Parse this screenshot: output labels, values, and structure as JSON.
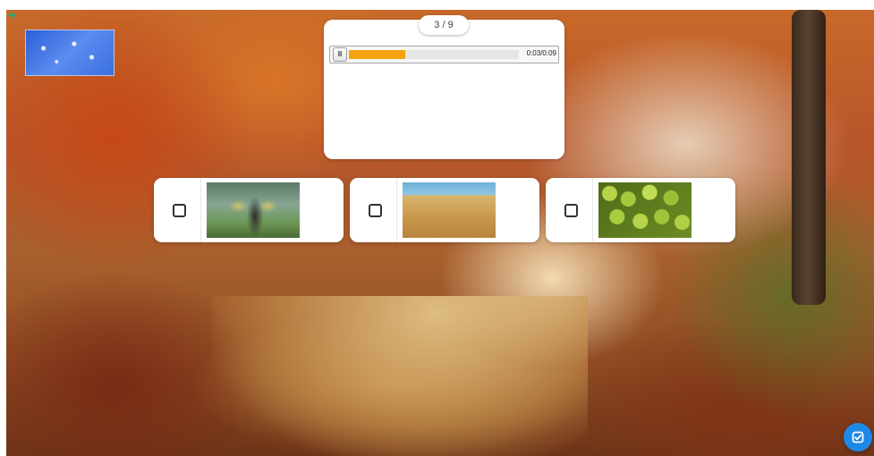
{
  "background": {
    "scene": "autumn forest road",
    "icon": "exit-arrow-icon"
  },
  "media_panel": {
    "counter": "3 / 9",
    "player": {
      "pause_icon": "pause-icon",
      "pause_glyph": "II",
      "progress_percent": 33,
      "time": "0:03/0:09",
      "accent_color": "#f5a30d"
    }
  },
  "options": [
    {
      "picture": "person carrying baskets in field"
    },
    {
      "picture": "person walking through wheat field"
    },
    {
      "picture": "pile of green pears"
    }
  ],
  "submit": {
    "icon": "check-square-icon",
    "color": "#1e88e5"
  }
}
